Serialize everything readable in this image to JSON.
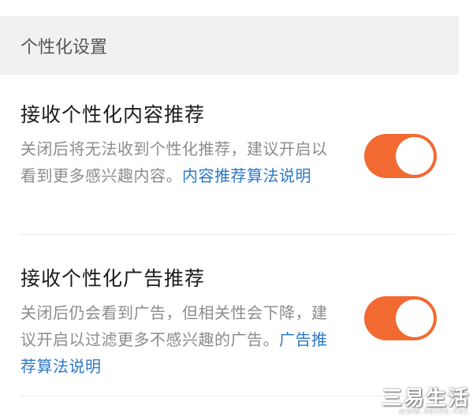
{
  "section": {
    "header": "个性化设置"
  },
  "settings": [
    {
      "title": "接收个性化内容推荐",
      "description": "关闭后将无法收到个性化推荐，建议开启以看到更多感兴趣内容。",
      "link": "内容推荐算法说明",
      "toggle_state": "on"
    },
    {
      "title": "接收个性化广告推荐",
      "description": "关闭后仍会看到广告，但相关性会下降，建议开启以过滤更多不感兴趣的广告。",
      "link": "广告推荐算法说明",
      "toggle_state": "on"
    }
  ],
  "colors": {
    "toggle_on": "#f26a32",
    "link": "#2c78c8",
    "section_bg": "#f1f1f1"
  },
  "watermark": {
    "text": "三易生活",
    "sub": "www.3elife.net"
  }
}
